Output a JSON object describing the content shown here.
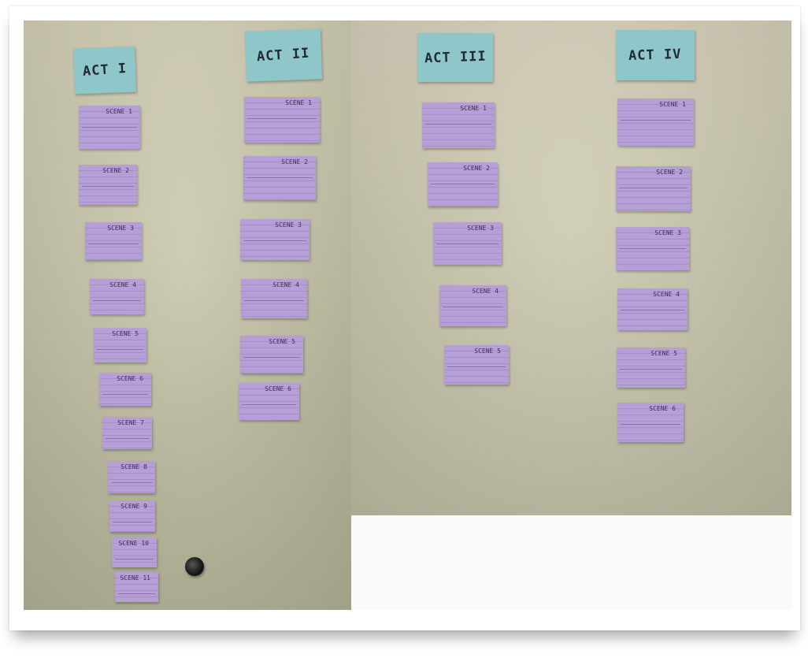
{
  "colors": {
    "act_card": "#8fc6c9",
    "scene_card": "#b59fd6",
    "wall": "#cbc8ad"
  },
  "acts": [
    {
      "title": "ACT I",
      "scenes": [
        "SCENE 1",
        "SCENE 2",
        "SCENE 3",
        "SCENE 4",
        "SCENE 5",
        "SCENE 6",
        "SCENE 7",
        "SCENE 8",
        "SCENE 9",
        "SCENE 10",
        "SCENE 11"
      ]
    },
    {
      "title": "ACT II",
      "scenes": [
        "SCENE 1",
        "SCENE 2",
        "SCENE 3",
        "SCENE 4",
        "SCENE 5",
        "SCENE 6"
      ]
    },
    {
      "title": "ACT III",
      "scenes": [
        "SCENE 1",
        "SCENE 2",
        "SCENE 3",
        "SCENE 4",
        "SCENE 5"
      ]
    },
    {
      "title": "ACT IV",
      "scenes": [
        "SCENE 1",
        "SCENE 2",
        "SCENE 3",
        "SCENE 4",
        "SCENE 5",
        "SCENE 6"
      ]
    }
  ]
}
